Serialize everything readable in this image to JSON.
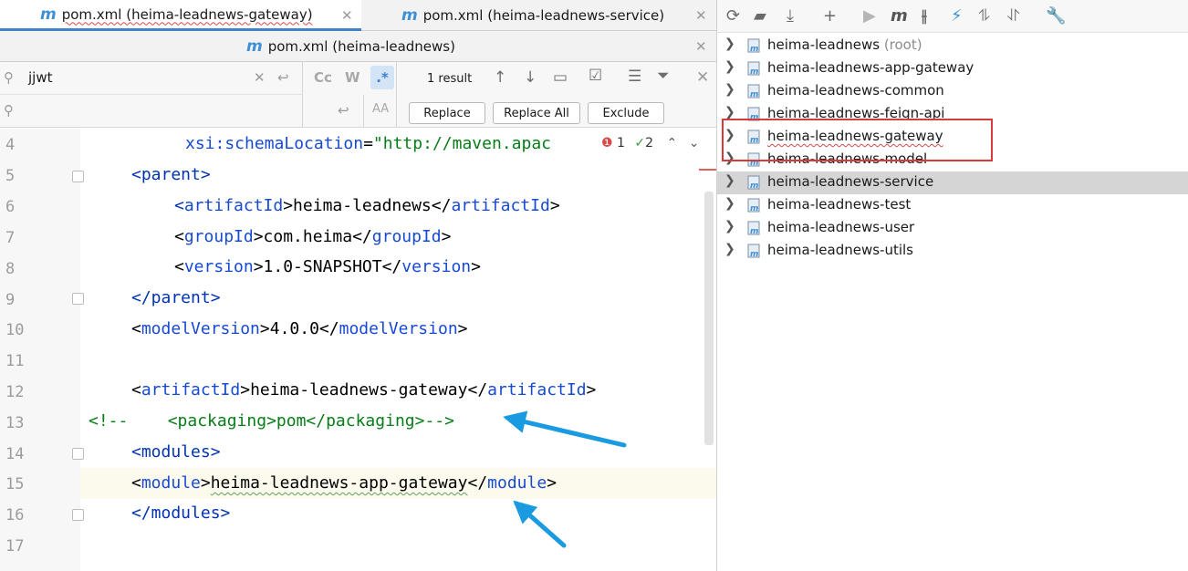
{
  "tabs": [
    {
      "label": "pom.xml (heima-leadnews-gateway)",
      "active": true
    },
    {
      "label": "pom.xml (heima-leadnews-service)",
      "active": false
    },
    {
      "label": "pom.xml (heima-leadnews)",
      "active": false
    }
  ],
  "find": {
    "query": "jjwt",
    "replace_value": "",
    "result_count": "1 result",
    "case_toggle": "Cc",
    "word_toggle": "W",
    "regex_toggle": ".*",
    "preserve_case": "AA",
    "replace_label": "Replace",
    "replace_all_label": "Replace All",
    "exclude_label": "Exclude"
  },
  "inspections": {
    "errors": "1",
    "warnings": "2"
  },
  "code": {
    "line_numbers": [
      "4",
      "5",
      "6",
      "7",
      "8",
      "9",
      "10",
      "11",
      "12",
      "13",
      "14",
      "15",
      "16",
      "17"
    ],
    "l4_attr": "xsi:schemaLocation",
    "l4_eq": "=",
    "l4_str": "\"http://maven.apac",
    "l5_open": "<parent>",
    "l6_pre": "<",
    "l6_tag": "artifactId",
    "l6_mid": ">heima-leadnews</",
    "l6_tag2": "artifactId",
    "l6_end": ">",
    "l7_tag": "groupId",
    "l7_val": "com.heima",
    "l8_tag": "version",
    "l8_val": "1.0-SNAPSHOT",
    "l9": "</parent>",
    "l10_tag": "modelVersion",
    "l10_val": "4.0.0",
    "l12_tag": "artifactId",
    "l12_val": "heima-leadnews-gateway",
    "l13": "<!--    <packaging>pom</packaging>-->",
    "l14": "<modules>",
    "l15_tag": "module",
    "l15_val": "heima-leadnews-app-gateway",
    "l16": "</modules>"
  },
  "maven": {
    "projects": [
      {
        "name": "heima-leadnews",
        "suffix": " (root)"
      },
      {
        "name": "heima-leadnews-app-gateway",
        "suffix": ""
      },
      {
        "name": "heima-leadnews-common",
        "suffix": ""
      },
      {
        "name": "heima-leadnews-feign-api",
        "suffix": ""
      },
      {
        "name": "heima-leadnews-gateway",
        "suffix": ""
      },
      {
        "name": "heima-leadnews-model",
        "suffix": ""
      },
      {
        "name": "heima-leadnews-service",
        "suffix": ""
      },
      {
        "name": "heima-leadnews-test",
        "suffix": ""
      },
      {
        "name": "heima-leadnews-user",
        "suffix": ""
      },
      {
        "name": "heima-leadnews-utils",
        "suffix": ""
      }
    ],
    "selected": "heima-leadnews-service",
    "highlighted": "heima-leadnews-gateway"
  },
  "colors": {
    "accent": "#4083c9",
    "annotation_box": "#d73a3a",
    "annotation_arrow": "#1a9ae0",
    "maven_icon": "#3d8fd6"
  }
}
